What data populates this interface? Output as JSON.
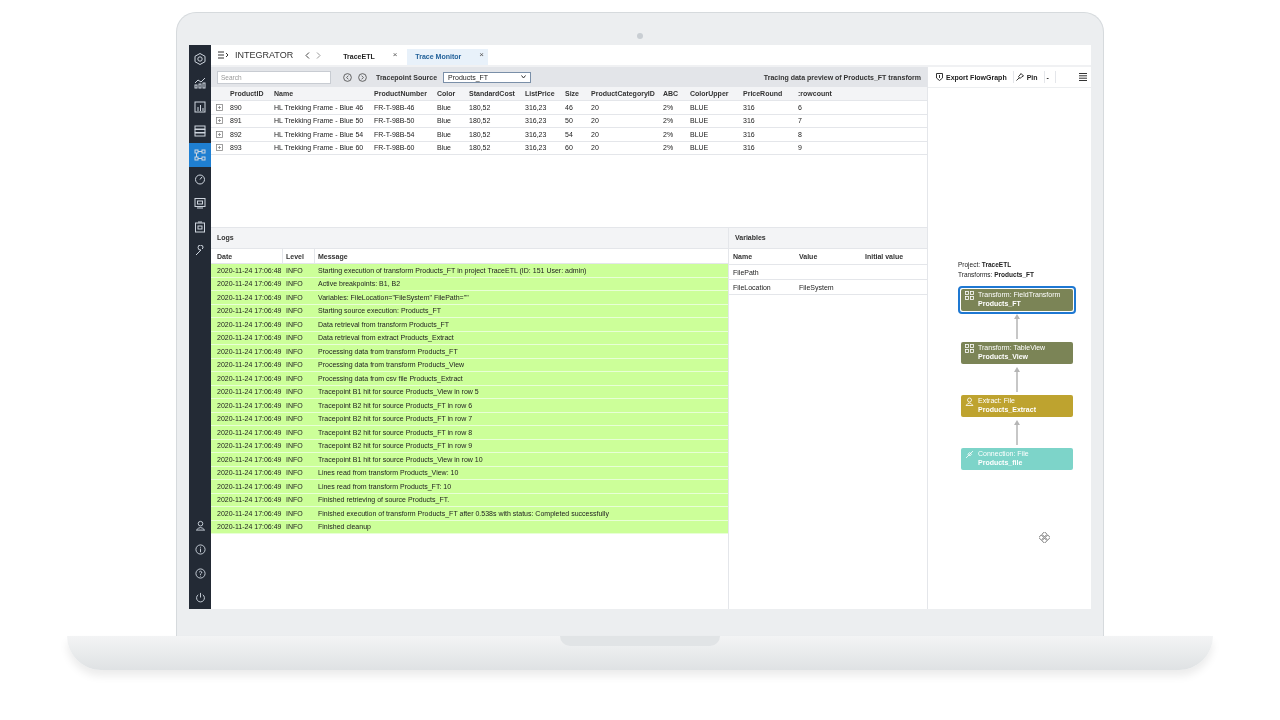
{
  "app": {
    "title": "INTEGRATOR"
  },
  "sidebar": {
    "items": [
      {
        "kind": "logo",
        "selected": false
      },
      {
        "kind": "analytics",
        "selected": false
      },
      {
        "kind": "report",
        "selected": false
      },
      {
        "kind": "database",
        "selected": false
      },
      {
        "kind": "flow",
        "selected": true
      },
      {
        "kind": "timer",
        "selected": false
      },
      {
        "kind": "monitor",
        "selected": false
      },
      {
        "kind": "package",
        "selected": false
      },
      {
        "kind": "wrench",
        "selected": false
      }
    ],
    "bottom": [
      {
        "kind": "user"
      },
      {
        "kind": "info"
      },
      {
        "kind": "help"
      },
      {
        "kind": "power"
      }
    ]
  },
  "tabs": [
    {
      "label": "TraceETL",
      "selected": false,
      "close": "×"
    },
    {
      "label": "Trace Monitor",
      "selected": true,
      "close": "×"
    }
  ],
  "toolbar": {
    "search": {
      "placeholder": "Search"
    },
    "source_label": "Tracepoint Source",
    "source": "Products_FT",
    "title": "Tracing data preview of Products_FT transform"
  },
  "data_table": {
    "columns": [
      "ProductID",
      "Name",
      "ProductNumber",
      "Color",
      "StandardCost",
      "ListPrice",
      "Size",
      "ProductCategoryID",
      "ABC",
      "ColorUpper",
      "PriceRound",
      ":rowcount"
    ],
    "rows": [
      {
        "expanded": false,
        "cells": [
          "890",
          "HL Trekking Frame - Blue 46",
          "FR-T-98B-46",
          "Blue",
          "180,52",
          "316,23",
          "46",
          "20",
          "2%",
          "BLUE",
          "316",
          "6"
        ]
      },
      {
        "expanded": false,
        "cells": [
          "891",
          "HL Trekking Frame - Blue 50",
          "FR-T-98B-50",
          "Blue",
          "180,52",
          "316,23",
          "50",
          "20",
          "2%",
          "BLUE",
          "316",
          "7"
        ]
      },
      {
        "expanded": false,
        "cells": [
          "892",
          "HL Trekking Frame - Blue 54",
          "FR-T-98B-54",
          "Blue",
          "180,52",
          "316,23",
          "54",
          "20",
          "2%",
          "BLUE",
          "316",
          "8"
        ]
      },
      {
        "expanded": false,
        "cells": [
          "893",
          "HL Trekking Frame - Blue 60",
          "FR-T-98B-60",
          "Blue",
          "180,52",
          "316,23",
          "60",
          "20",
          "2%",
          "BLUE",
          "316",
          "9"
        ]
      }
    ]
  },
  "logs": {
    "title": "Logs",
    "columns": [
      "Date",
      "Level",
      "Message"
    ],
    "rows": [
      [
        "2020-11-24 17:06:48",
        "INFO",
        "Starting execution of transform Products_FT in project TraceETL (ID: 151 User: admin)"
      ],
      [
        "2020-11-24 17:06:49",
        "INFO",
        "Active breakpoints: B1, B2"
      ],
      [
        "2020-11-24 17:06:49",
        "INFO",
        "Variables: FileLocation=\"FileSystem\" FilePath=\"\""
      ],
      [
        "2020-11-24 17:06:49",
        "INFO",
        "Starting source execution: Products_FT"
      ],
      [
        "2020-11-24 17:06:49",
        "INFO",
        "Data retrieval from transform Products_FT"
      ],
      [
        "2020-11-24 17:06:49",
        "INFO",
        "Data retrieval from extract Products_Extract"
      ],
      [
        "2020-11-24 17:06:49",
        "INFO",
        "Processing data from transform Products_FT"
      ],
      [
        "2020-11-24 17:06:49",
        "INFO",
        "Processing data from transform Products_View"
      ],
      [
        "2020-11-24 17:06:49",
        "INFO",
        "Processing data from csv file Products_Extract"
      ],
      [
        "2020-11-24 17:06:49",
        "INFO",
        "Tracepoint B1 hit for source Products_View in row 5"
      ],
      [
        "2020-11-24 17:06:49",
        "INFO",
        "Tracepoint B2 hit for source Products_FT in row 6"
      ],
      [
        "2020-11-24 17:06:49",
        "INFO",
        "Tracepoint B2 hit for source Products_FT in row 7"
      ],
      [
        "2020-11-24 17:06:49",
        "INFO",
        "Tracepoint B2 hit for source Products_FT in row 8"
      ],
      [
        "2020-11-24 17:06:49",
        "INFO",
        "Tracepoint B2 hit for source Products_FT in row 9"
      ],
      [
        "2020-11-24 17:06:49",
        "INFO",
        "Tracepoint B1 hit for source Products_View in row 10"
      ],
      [
        "2020-11-24 17:06:49",
        "INFO",
        "Lines read from transform Products_View: 10"
      ],
      [
        "2020-11-24 17:06:49",
        "INFO",
        "Lines read from transform Products_FT: 10"
      ],
      [
        "2020-11-24 17:06:49",
        "INFO",
        "Finished retrieving of source Products_FT."
      ],
      [
        "2020-11-24 17:06:49",
        "INFO",
        "Finished execution of transform Products_FT after 0.538s with status: Completed successfully"
      ],
      [
        "2020-11-24 17:06:49",
        "INFO",
        "Finished cleanup"
      ]
    ]
  },
  "variables": {
    "title": "Variables",
    "columns": [
      "Name",
      "Value",
      "Initial value"
    ],
    "rows": [
      [
        "FilePath"
      ],
      [
        "FileLocation",
        "FileSystem"
      ]
    ]
  },
  "flowgraph": {
    "toolbar": [
      {
        "label": "Export FlowGraph",
        "kind": "export"
      },
      {
        "label": "Pin",
        "kind": "pin"
      },
      {
        "label": "-",
        "kind": "plain"
      }
    ],
    "project": "Project: **TraceETL**",
    "transforms": "Transforms: **Products_FT**",
    "nodes": [
      {
        "kind": "transform",
        "type": "Transform: FieldTransform",
        "name": "Products_FT",
        "color": "#7b8456",
        "selected": true
      },
      {
        "kind": "transform",
        "type": "Transform: TableView",
        "name": "Products_View",
        "color": "#7b8456",
        "selected": false
      },
      {
        "kind": "extract",
        "type": "Extract: File",
        "name": "Products_Extract",
        "color": "#bea32f",
        "selected": false
      },
      {
        "kind": "connection",
        "type": "Connection: File",
        "name": "Products_file",
        "color": "#7dd4c9",
        "selected": false
      }
    ]
  }
}
